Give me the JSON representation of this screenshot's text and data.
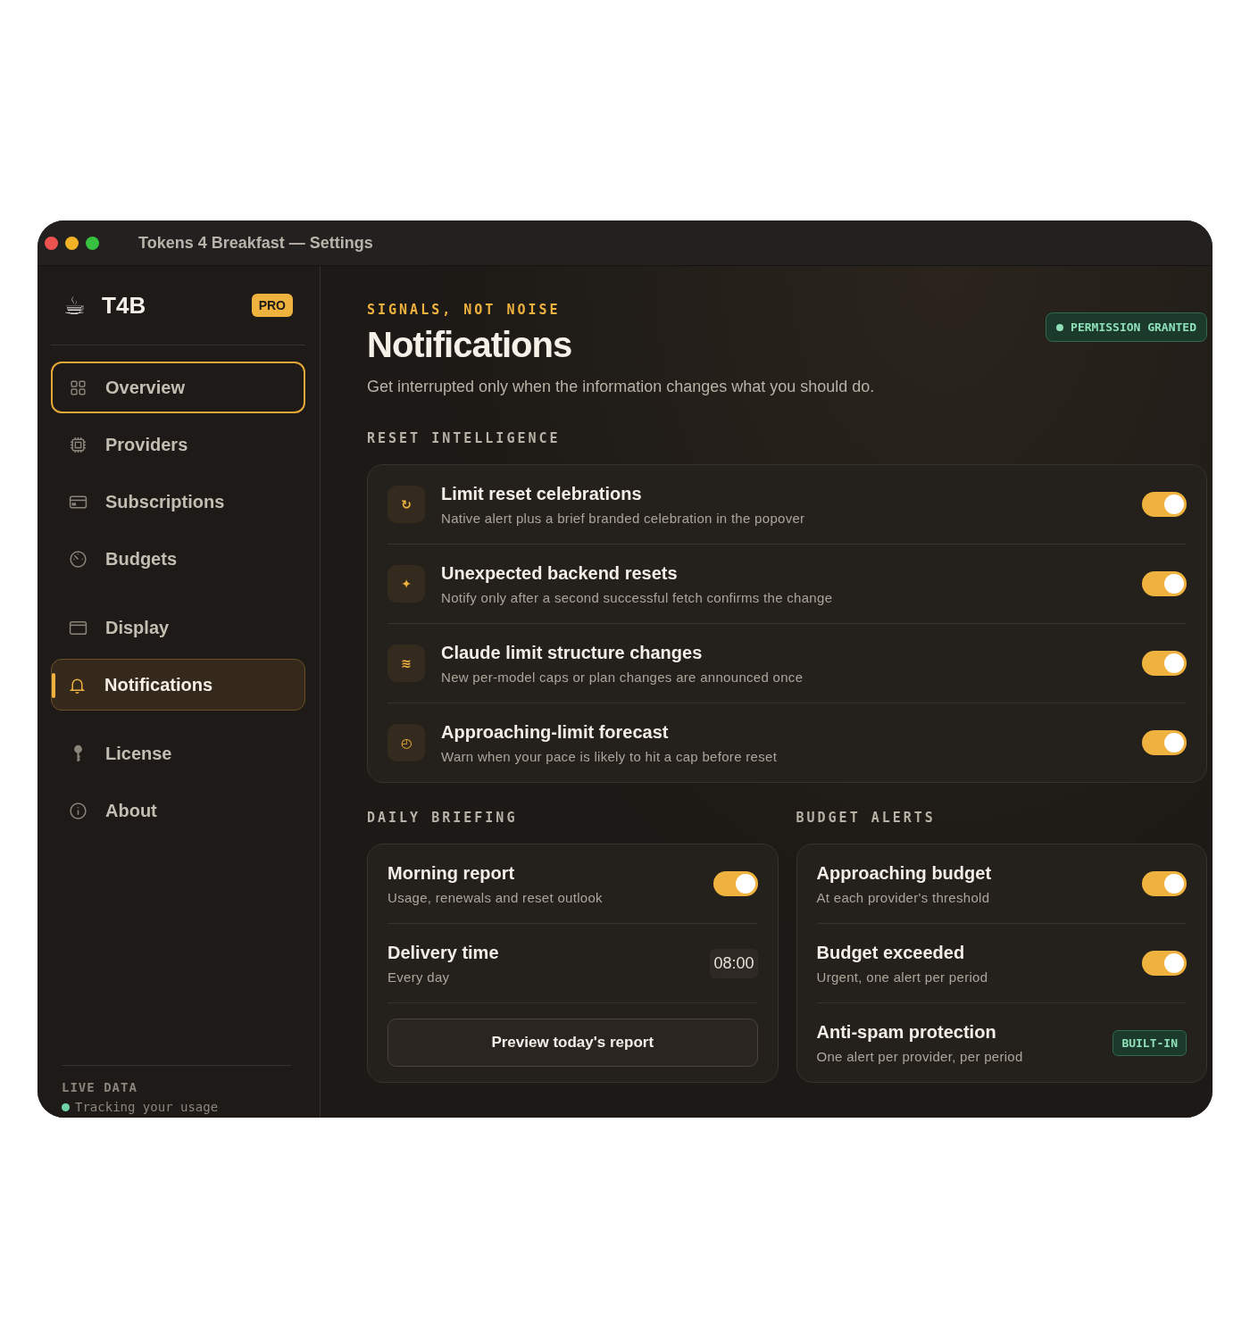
{
  "window": {
    "title": "Tokens 4 Breakfast — Settings"
  },
  "sidebar": {
    "brand": {
      "logo": "☕",
      "name": "T4B",
      "badge": "PRO"
    },
    "groups": [
      {
        "items": [
          {
            "label": "Overview",
            "selected": false,
            "focused": true
          },
          {
            "label": "Providers",
            "selected": false,
            "focused": false
          },
          {
            "label": "Subscriptions",
            "selected": false,
            "focused": false
          },
          {
            "label": "Budgets",
            "selected": false,
            "focused": false
          }
        ]
      },
      {
        "items": [
          {
            "label": "Display",
            "selected": false,
            "focused": false
          },
          {
            "label": "Notifications",
            "selected": true,
            "focused": false
          }
        ]
      },
      {
        "items": [
          {
            "label": "License",
            "selected": false,
            "focused": false
          },
          {
            "label": "About",
            "selected": false,
            "focused": false
          }
        ]
      }
    ],
    "footer": {
      "heading": "LIVE DATA",
      "status": "Tracking your usage"
    }
  },
  "main": {
    "eyebrow": "SIGNALS, NOT NOISE",
    "title": "Notifications",
    "subtitle": "Get interrupted only when the information changes what you should do.",
    "permission_badge": "PERMISSION GRANTED",
    "reset_intelligence": {
      "heading": "RESET INTELLIGENCE",
      "rows": [
        {
          "icon": "↻",
          "title": "Limit reset celebrations",
          "description": "Native alert plus a brief branded celebration in the popover",
          "on": true
        },
        {
          "icon": "✦",
          "title": "Unexpected backend resets",
          "description": "Notify only after a second successful fetch confirms the change",
          "on": true
        },
        {
          "icon": "≋",
          "title": "Claude limit structure changes",
          "description": "New per-model caps or plan changes are announced once",
          "on": true
        },
        {
          "icon": "◴",
          "title": "Approaching-limit forecast",
          "description": "Warn when your pace is likely to hit a cap before reset",
          "on": true
        }
      ]
    },
    "daily_briefing": {
      "heading": "DAILY BRIEFING",
      "rows": [
        {
          "kind": "toggle",
          "title": "Morning report",
          "description": "Usage, renewals and reset outlook",
          "on": true
        },
        {
          "kind": "time",
          "title": "Delivery time",
          "description": "Every day",
          "value": "08:00"
        },
        {
          "kind": "button",
          "label": "Preview today's report"
        }
      ]
    },
    "budget_alerts": {
      "heading": "BUDGET ALERTS",
      "rows": [
        {
          "kind": "toggle",
          "title": "Approaching budget",
          "description": "At each provider's threshold",
          "on": true
        },
        {
          "kind": "toggle",
          "title": "Budget exceeded",
          "description": "Urgent, one alert per period",
          "on": true
        },
        {
          "kind": "badge",
          "title": "Anti-spam protection",
          "description": "One alert per provider, per period",
          "badge": "BUILT-IN"
        }
      ]
    }
  }
}
